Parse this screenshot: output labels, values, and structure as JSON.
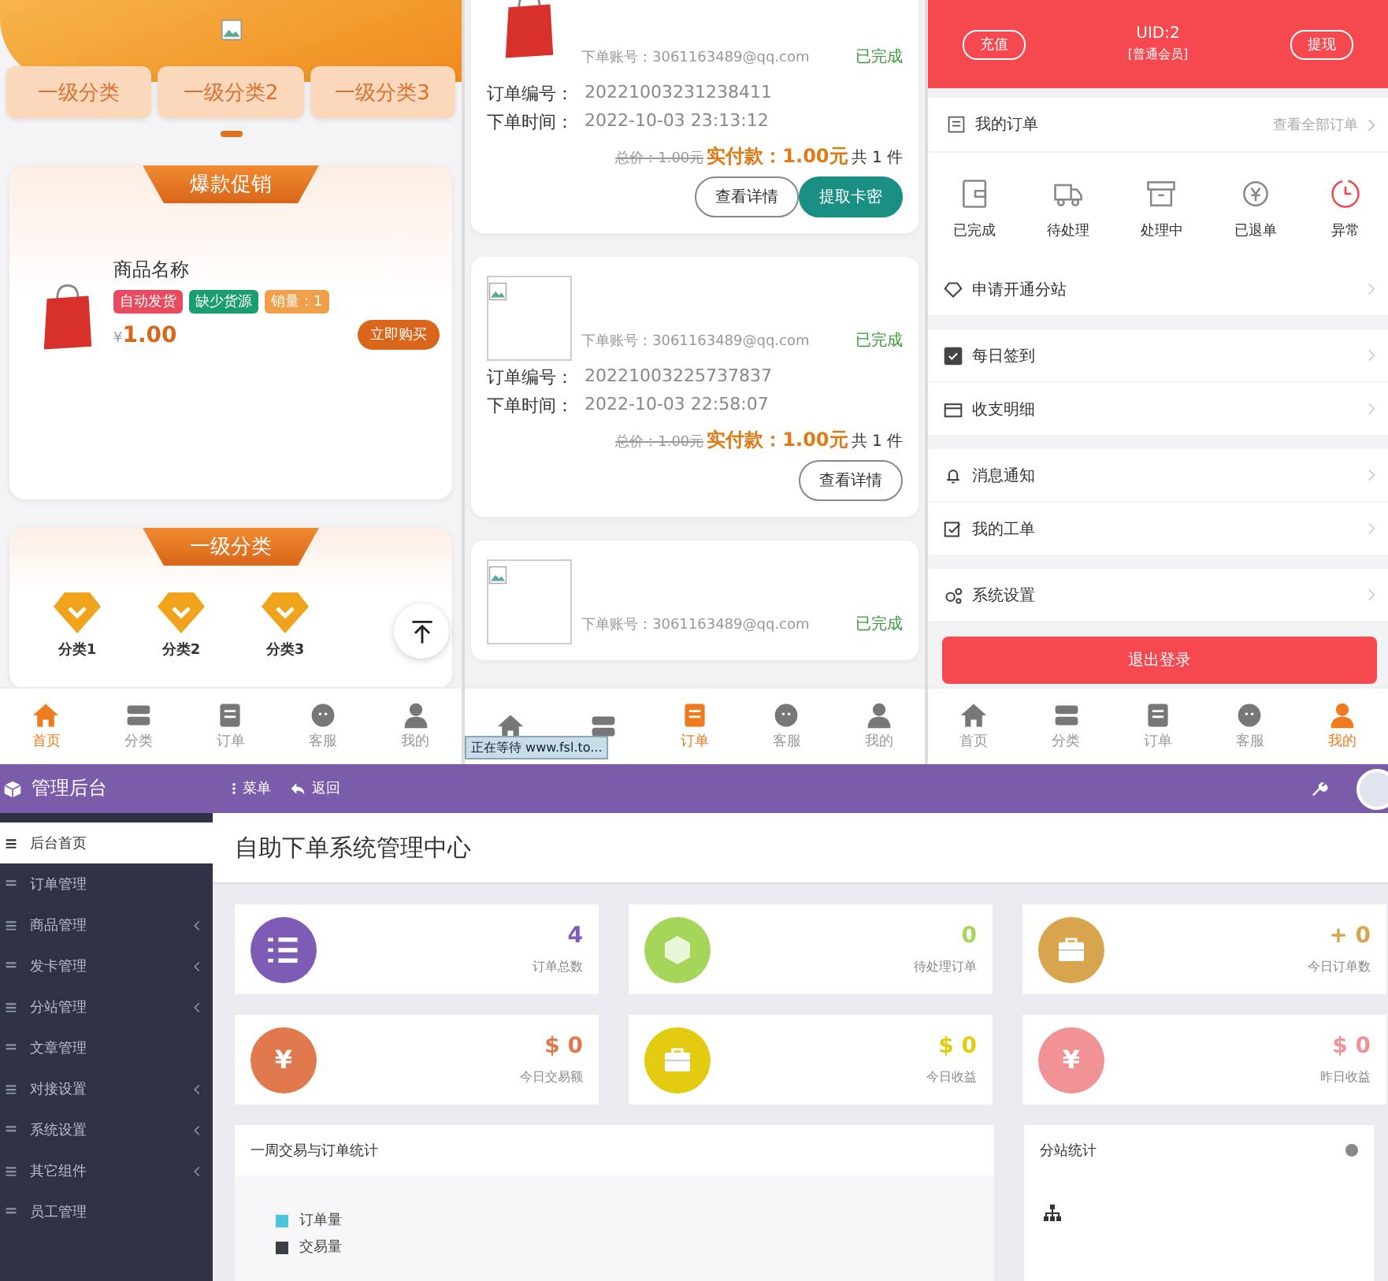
{
  "home": {
    "categories": [
      {
        "label": "一级分类"
      },
      {
        "label": "一级分类2"
      },
      {
        "label": "一级分类3"
      }
    ],
    "promo_title": "爆款促销",
    "product": {
      "name": "商品名称",
      "tags": [
        {
          "label": "自动发货",
          "color": "#e84a5f"
        },
        {
          "label": "缺少货源",
          "color": "#1a9e6e"
        },
        {
          "label": "销量：1",
          "color": "#f0a04b"
        }
      ],
      "currency": "¥",
      "price": "1.00",
      "buy_button": "立即购买"
    },
    "category_title": "一级分类",
    "subcategories": [
      {
        "label": "分类1"
      },
      {
        "label": "分类2"
      },
      {
        "label": "分类3"
      }
    ],
    "nav": [
      {
        "label": "首页",
        "selected": true
      },
      {
        "label": "分类",
        "selected": false
      },
      {
        "label": "订单",
        "selected": false
      },
      {
        "label": "客服",
        "selected": false
      },
      {
        "label": "我的",
        "selected": false
      }
    ]
  },
  "orders": {
    "items": [
      {
        "kind": "sale",
        "account": "下单账号：3061163489@qq.com",
        "status": "已完成",
        "order_no_label": "订单编号：",
        "order_no": "20221003231238411",
        "time_label": "下单时间：",
        "time": "2022-10-03 23:13:12",
        "total": "总价：1.00元",
        "paid": "实付款：1.00元",
        "count": "共 1 件",
        "buttons": [
          {
            "label": "查看详情",
            "kind": "outline"
          },
          {
            "label": "提取卡密",
            "kind": "filled"
          }
        ]
      },
      {
        "kind": "broken",
        "account": "下单账号：3061163489@qq.com",
        "status": "已完成",
        "order_no_label": "订单编号：",
        "order_no": "20221003225737837",
        "time_label": "下单时间：",
        "time": "2022-10-03 22:58:07",
        "total": "总价：1.00元",
        "paid": "实付款：1.00元",
        "count": "共 1 件",
        "buttons": [
          {
            "label": "查看详情",
            "kind": "outline"
          }
        ]
      },
      {
        "kind": "broken",
        "account": "下单账号：3061163489@qq.com",
        "status": "已完成"
      }
    ],
    "nav": [
      {
        "selected": false
      },
      {
        "selected": false
      },
      {
        "label": "订单",
        "selected": true
      },
      {
        "label": "客服",
        "selected": false
      },
      {
        "label": "我的",
        "selected": false
      }
    ],
    "browser_status": "正在等待 www.fsl.to..."
  },
  "profile": {
    "recharge_button": "充值",
    "uid": "UID:2",
    "level": "[普通会员]",
    "withdraw_button": "提现",
    "my_orders": "我的订单",
    "view_all": "查看全部订单",
    "order_states": [
      {
        "label": "已完成",
        "alert": false
      },
      {
        "label": "待处理",
        "alert": false
      },
      {
        "label": "处理中",
        "alert": false
      },
      {
        "label": "已退单",
        "alert": false
      },
      {
        "label": "异常",
        "alert": true
      }
    ],
    "menu_groups": [
      [
        {
          "label": "申请开通分站"
        }
      ],
      [
        {
          "label": "每日签到"
        },
        {
          "label": "收支明细"
        }
      ],
      [
        {
          "label": "消息通知"
        },
        {
          "label": "我的工单"
        }
      ],
      [
        {
          "label": "系统设置"
        }
      ]
    ],
    "logout_button": "退出登录",
    "nav": [
      {
        "label": "首页",
        "selected": false
      },
      {
        "label": "分类",
        "selected": false
      },
      {
        "label": "订单",
        "selected": false
      },
      {
        "label": "客服",
        "selected": false
      },
      {
        "label": "我的",
        "selected": true
      }
    ]
  },
  "admin": {
    "brand": "管理后台",
    "menu_button": "菜单",
    "back_button": "返回",
    "page_title": "自助下单系统管理中心",
    "sidebar": [
      {
        "label": "后台首页",
        "selected": true,
        "submenu": false
      },
      {
        "label": "订单管理",
        "selected": false,
        "submenu": false
      },
      {
        "label": "商品管理",
        "selected": false,
        "submenu": true
      },
      {
        "label": "发卡管理",
        "selected": false,
        "submenu": true
      },
      {
        "label": "分站管理",
        "selected": false,
        "submenu": true
      },
      {
        "label": "文章管理",
        "selected": false,
        "submenu": false
      },
      {
        "label": "对接设置",
        "selected": false,
        "submenu": true
      },
      {
        "label": "系统设置",
        "selected": false,
        "submenu": true
      },
      {
        "label": "其它组件",
        "selected": false,
        "submenu": true
      },
      {
        "label": "员工管理",
        "selected": false,
        "submenu": false
      }
    ],
    "stats": [
      {
        "kind": "list",
        "value": "4",
        "label": "订单总数",
        "color": "#7e5bb5"
      },
      {
        "kind": "hexagon",
        "value": "0",
        "label": "待处理订单",
        "color": "#a5d65a"
      },
      {
        "kind": "briefcase",
        "value": "+ 0",
        "label": "今日订单数",
        "color": "#d9a54c"
      },
      {
        "kind": "glyph",
        "glyph": "¥",
        "value": "$ 0",
        "label": "今日交易额",
        "color": "#e07a4e"
      },
      {
        "kind": "briefcase",
        "value": "$ 0",
        "label": "今日收益",
        "color": "#e3cc10"
      },
      {
        "kind": "glyph",
        "glyph": "¥",
        "value": "$ 0",
        "label": "昨日收益",
        "color": "#f19396"
      }
    ],
    "chart_panel": {
      "title": "一周交易与订单统计",
      "legend": [
        {
          "label": "订单量",
          "color": "#4fc3dc"
        },
        {
          "label": "交易量",
          "color": "#3a3f4c"
        }
      ]
    },
    "site_panel": {
      "title": "分站统计"
    }
  }
}
